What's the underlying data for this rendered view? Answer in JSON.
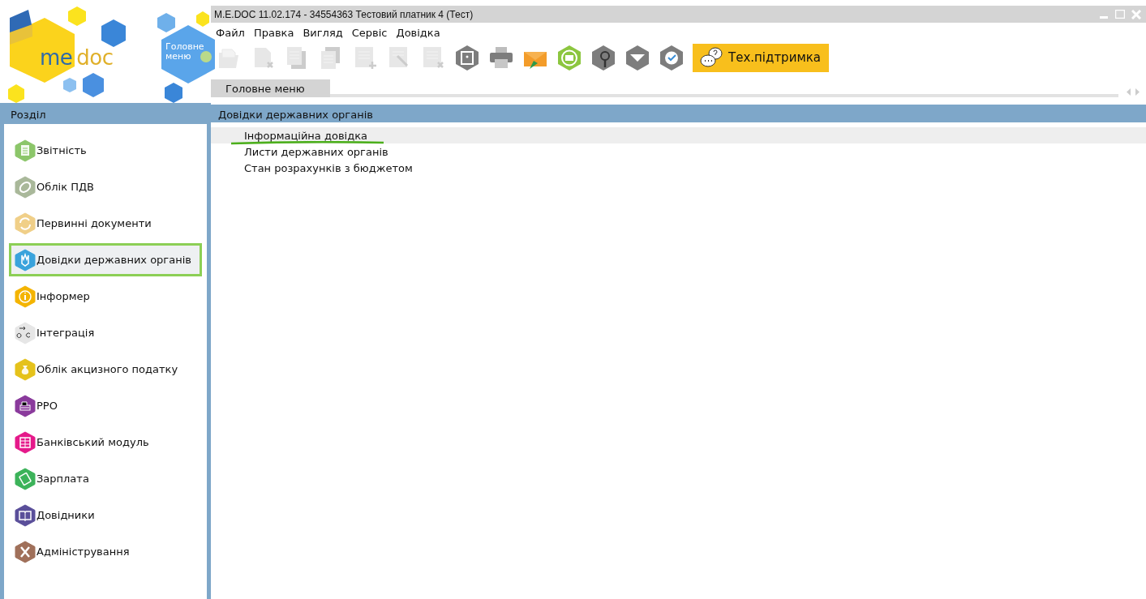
{
  "logo": {
    "text_1": "me",
    "text_2": "doc"
  },
  "main_menu_button": {
    "label": "Головне меню"
  },
  "window": {
    "title": "M.E.DOC 11.02.174  - 34554363 Тестовий платник 4 (Тест)"
  },
  "menu": [
    "Файл",
    "Правка",
    "Вигляд",
    "Сервіс",
    "Довідка"
  ],
  "toolbar": [
    {
      "kind": "folder",
      "disabled": true
    },
    {
      "kind": "delete-doc",
      "disabled": true
    },
    {
      "kind": "copy",
      "disabled": true
    },
    {
      "kind": "copy-edit",
      "disabled": true
    },
    {
      "kind": "add-doc",
      "disabled": true
    },
    {
      "kind": "edit-doc",
      "disabled": true
    },
    {
      "kind": "delete-list",
      "disabled": true
    },
    {
      "kind": "safe",
      "disabled": false
    },
    {
      "kind": "printer",
      "disabled": false
    },
    {
      "kind": "mail-send",
      "disabled": false
    },
    {
      "kind": "mail-sync",
      "disabled": false
    },
    {
      "kind": "search",
      "disabled": false
    },
    {
      "kind": "filter",
      "disabled": false
    },
    {
      "kind": "check-sync",
      "disabled": false
    }
  ],
  "support_button": {
    "label": "Тех.підтримка"
  },
  "tabs": [
    {
      "label": "Головне меню",
      "selected": true
    }
  ],
  "sidebar": {
    "title": "Розділ",
    "items": [
      {
        "label": "Звітність",
        "kind": "document",
        "color": "#8cc66a",
        "selected": false
      },
      {
        "label": "Облік ПДВ",
        "kind": "coin",
        "color": "#a9b89a",
        "selected": false
      },
      {
        "label": "Первинні документи",
        "kind": "cycle",
        "color": "#f0cf88",
        "selected": false
      },
      {
        "label": "Довідки державних органів",
        "kind": "emblem",
        "color": "#3aa3dc",
        "selected": true
      },
      {
        "label": "Інформер",
        "kind": "info",
        "color": "#f4b400",
        "selected": false
      },
      {
        "label": "Інтеграція",
        "kind": "arrow",
        "color": "#e6e6e6",
        "selected": false
      },
      {
        "label": "Облік акцизного податку",
        "kind": "bag",
        "color": "#e5c21b",
        "selected": false
      },
      {
        "label": "РРО",
        "kind": "register",
        "color": "#8a3a9c",
        "selected": false
      },
      {
        "label": "Банківський модуль",
        "kind": "bank",
        "color": "#e5198a",
        "selected": false
      },
      {
        "label": "Зарплата",
        "kind": "money",
        "color": "#3cb35a",
        "selected": false
      },
      {
        "label": "Довідники",
        "kind": "book",
        "color": "#5a4f9a",
        "selected": false
      },
      {
        "label": "Адміністрування",
        "kind": "tools",
        "color": "#a0705a",
        "selected": false
      }
    ]
  },
  "content": {
    "title": "Довідки державних органів",
    "items": [
      {
        "label": "Інформаційна довідка",
        "selected": true
      },
      {
        "label": "Листи державних органів",
        "selected": false
      },
      {
        "label": "Стан розрахунків з бюджетом",
        "selected": false
      }
    ]
  }
}
